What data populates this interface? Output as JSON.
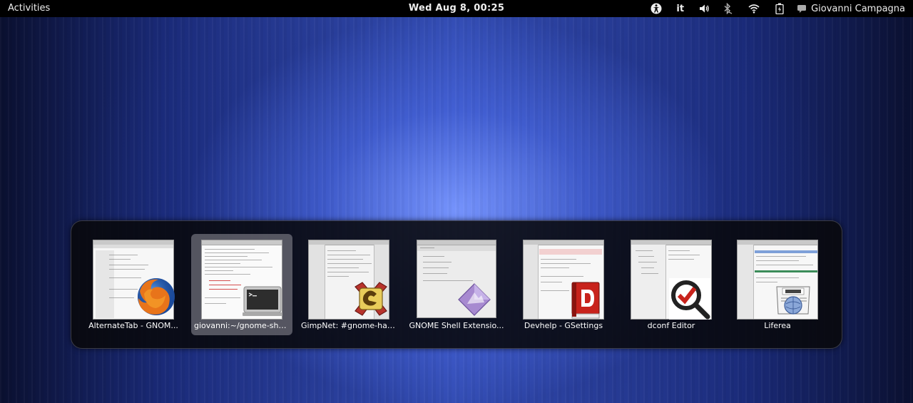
{
  "topbar": {
    "activities_label": "Activities",
    "clock": "Wed Aug  8, 00:25",
    "keyboard_layout": "it",
    "user_name": "Giovanni Campagna",
    "icons": [
      "accessibility-icon",
      "keyboard-layout",
      "volume-icon",
      "bluetooth-icon",
      "wifi-icon",
      "battery-icon",
      "chat-status-icon"
    ]
  },
  "switcher": {
    "selected_index": 1,
    "items": [
      {
        "label": "AlternateTab - GNOM...",
        "app_icon": "firefox-icon"
      },
      {
        "label": "giovanni:~/gnome-shell...",
        "app_icon": "terminal-icon"
      },
      {
        "label": "GimpNet: #gnome-hac...",
        "app_icon": "xchat-icon"
      },
      {
        "label": "GNOME Shell Extensio...",
        "app_icon": "extension-prefs-icon"
      },
      {
        "label": "Devhelp - GSettings",
        "app_icon": "devhelp-icon"
      },
      {
        "label": "dconf Editor",
        "app_icon": "dconf-editor-icon"
      },
      {
        "label": "Liferea",
        "app_icon": "liferea-icon"
      }
    ]
  },
  "colors": {
    "topbar_bg": "#000000",
    "switcher_bg": "#08080a",
    "selection": "#6e6e78",
    "desktop_accent": "#3a55c0"
  }
}
